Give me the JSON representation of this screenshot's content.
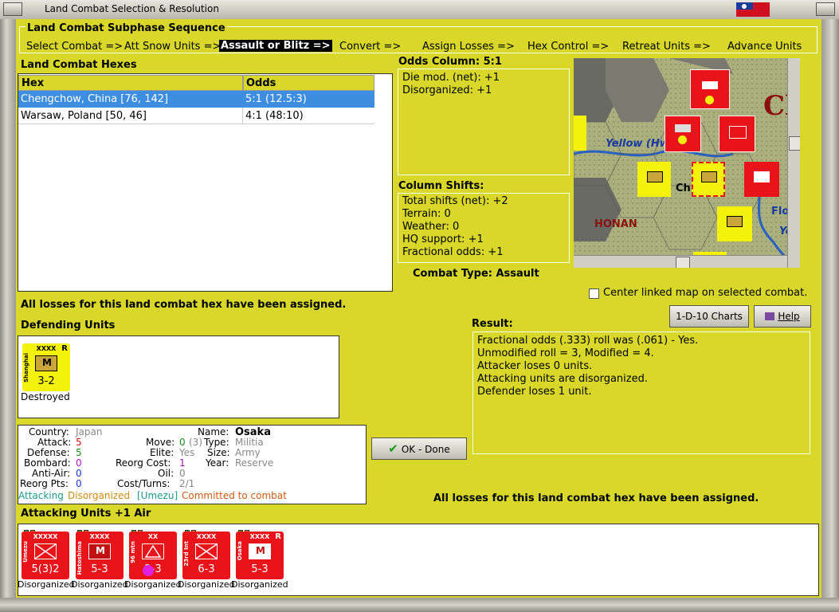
{
  "window": {
    "title": "Land Combat Selection & Resolution"
  },
  "subphase": {
    "title": "Land Combat Subphase Sequence",
    "steps": [
      "Select Combat =>",
      "Att Snow Units =>",
      "Assault or Blitz =>",
      "Convert =>",
      "Assign Losses =>",
      "Hex Control =>",
      "Retreat Units =>",
      "Advance Units"
    ]
  },
  "hexes": {
    "title": "Land Combat Hexes",
    "col_hex": "Hex",
    "col_odds": "Odds",
    "rows": [
      {
        "hex": "Chengchow, China [76, 142]",
        "odds": "5:1 (12.5:3)"
      },
      {
        "hex": "Warsaw, Poland [50, 46]",
        "odds": "4:1 (48:10)"
      }
    ]
  },
  "odds": {
    "title": "Odds Column: 5:1",
    "lines": [
      "Die mod. (net): +1",
      "Disorganized: +1"
    ]
  },
  "shifts": {
    "title": "Column Shifts:",
    "lines": [
      "Total shifts (net): +2",
      "Terrain: 0",
      "Weather: 0",
      "HQ support: +1",
      "Fractional odds: +1"
    ]
  },
  "combat_type": "Combat Type:  Assault",
  "map": {
    "labels": [
      "Yellow (Hw",
      "Ch",
      "HONAN",
      "Flood",
      "Yel",
      "Cl"
    ],
    "center_checkbox": "Center linked map on selected combat."
  },
  "losses_msg_top": "All losses for this land combat hex have been assigned.",
  "buttons": {
    "charts": "1-D-10 Charts",
    "help": "Help",
    "ok": "OK - Done"
  },
  "result": {
    "title": "Result:",
    "lines": [
      "Fractional odds (.333) roll was (.061)  - Yes.",
      "Unmodified roll = 3, Modified = 4.",
      "Attacker loses 0 units.",
      "Attacking units are disorganized.",
      "Defender loses 1 unit."
    ]
  },
  "defending": {
    "title": "Defending Units",
    "units": [
      {
        "size": "XXXX",
        "name": "Shanghai",
        "symbol": "M",
        "strength": "3-2",
        "reserve": "R",
        "status": "Destroyed"
      }
    ]
  },
  "info": {
    "country_label": "Country:",
    "country": "Japan",
    "attack_label": "Attack:",
    "attack": "5",
    "defense_label": "Defense:",
    "defense": "5",
    "bombard_label": "Bombard:",
    "bombard": "0",
    "antiair_label": "Anti-Air:",
    "antiair": "0",
    "reorgpts_label": "Reorg Pts:",
    "reorgpts": "0",
    "name_label": "Name:",
    "name": "Osaka",
    "move_label": "Move:",
    "move": "0",
    "move_paren": "(3)",
    "type_label": "Type:",
    "type": "Militia",
    "elite_label": "Elite:",
    "elite": "Yes",
    "size_label": "Size:",
    "size": "Army",
    "reorgcost_label": "Reorg Cost:",
    "reorgcost": "1",
    "year_label": "Year:",
    "year": "Reserve",
    "oil_label": "Oil:",
    "oil": "0",
    "costturns_label": "Cost/Turns:",
    "costturns": "2/1",
    "status_attacking": "Attacking",
    "status_disorg": "Disorganized",
    "status_hq": "[Umezu]",
    "status_committed": "Committed to combat"
  },
  "losses_msg_bottom": "All losses for this land combat hex have been assigned.",
  "attacking": {
    "title": "Attacking Units +1 Air",
    "units": [
      {
        "size": "XXXXX",
        "name": "Umezu",
        "strength": "5(3)2",
        "status": "Disorganized"
      },
      {
        "size": "XXXX",
        "name": "Hatoshima",
        "symbol": "M",
        "strength": "5-3",
        "status": "Disorganized"
      },
      {
        "size": "XX",
        "name": "96 mtn",
        "strength": "2-3",
        "status": "Disorganized"
      },
      {
        "size": "XXXX",
        "name": "23rd Int",
        "strength": "6-3",
        "status": "Disorganized"
      },
      {
        "size": "XXXX",
        "name": "Osaka",
        "symbol": "M",
        "strength": "5-3",
        "reserve": "R",
        "status": "Disorganized"
      }
    ]
  },
  "colors": {
    "panel_bg": "#d9d72a",
    "selected_row": "#3d8ee0",
    "japan_unit": "#e8141a",
    "china_unit": "#f4f20a"
  }
}
